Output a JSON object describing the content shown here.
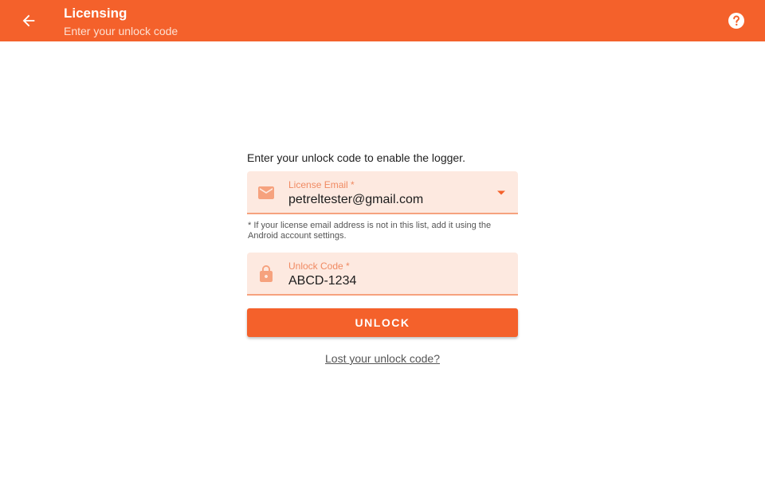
{
  "appbar": {
    "title": "Licensing",
    "subtitle": "Enter your unlock code",
    "back_icon": "arrow-left-icon",
    "help_icon": "help-circle-icon"
  },
  "form": {
    "intro": "Enter your unlock code to enable the logger.",
    "email": {
      "label": "License Email *",
      "value": "petreltester@gmail.com",
      "icon": "email-icon"
    },
    "note": "* If your license email address is not in this list, add it using the Android account settings.",
    "code": {
      "label": "Unlock Code *",
      "value": "ABCD-1234",
      "icon": "lock-icon"
    },
    "unlock_label": "UNLOCK",
    "lost_link": "Lost your unlock code?"
  },
  "colors": {
    "accent": "#f4612b",
    "field_bg": "#fde9e0",
    "field_label": "#f08a62"
  }
}
